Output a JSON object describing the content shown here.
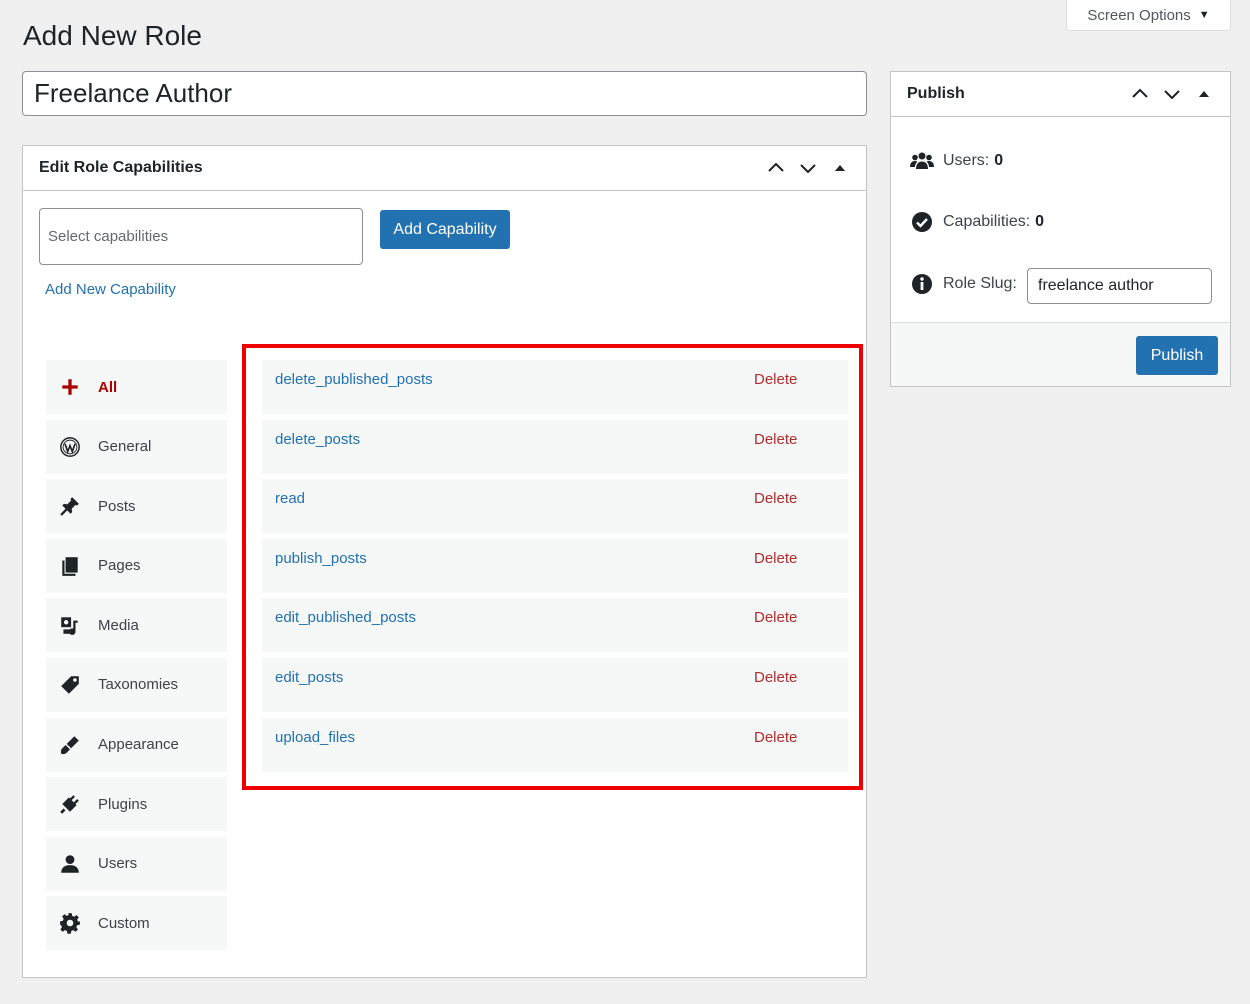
{
  "screen_options": {
    "label": "Screen Options",
    "caret": "▼"
  },
  "page_title": "Add New Role",
  "role_name": "Freelance Author",
  "capabilities_box": {
    "title": "Edit Role Capabilities",
    "select_placeholder": "Select capabilities",
    "add_button": "Add Capability",
    "add_new_link": "Add New Capability",
    "groups": [
      {
        "label": "All",
        "icon": "plus-icon",
        "active": true
      },
      {
        "label": "General",
        "icon": "wordpress-icon"
      },
      {
        "label": "Posts",
        "icon": "pushpin-icon"
      },
      {
        "label": "Pages",
        "icon": "pages-icon"
      },
      {
        "label": "Media",
        "icon": "media-icon"
      },
      {
        "label": "Taxonomies",
        "icon": "tag-icon"
      },
      {
        "label": "Appearance",
        "icon": "paintbrush-icon"
      },
      {
        "label": "Plugins",
        "icon": "plugin-icon"
      },
      {
        "label": "Users",
        "icon": "user-icon"
      },
      {
        "label": "Custom",
        "icon": "gear-icon"
      }
    ],
    "capabilities": [
      {
        "name": "delete_published_posts",
        "action": "Delete"
      },
      {
        "name": "delete_posts",
        "action": "Delete"
      },
      {
        "name": "read",
        "action": "Delete"
      },
      {
        "name": "publish_posts",
        "action": "Delete"
      },
      {
        "name": "edit_published_posts",
        "action": "Delete"
      },
      {
        "name": "edit_posts",
        "action": "Delete"
      },
      {
        "name": "upload_files",
        "action": "Delete"
      }
    ],
    "highlight_color": "#e00000"
  },
  "publish_box": {
    "title": "Publish",
    "users_label": "Users:",
    "users_count": "0",
    "capabilities_label": "Capabilities:",
    "capabilities_count": "0",
    "slug_label": "Role Slug:",
    "slug_value": "freelance author",
    "publish_button": "Publish"
  },
  "colors": {
    "primary": "#2271b1",
    "delete": "#b32d2e",
    "active_group": "#aa0000"
  }
}
